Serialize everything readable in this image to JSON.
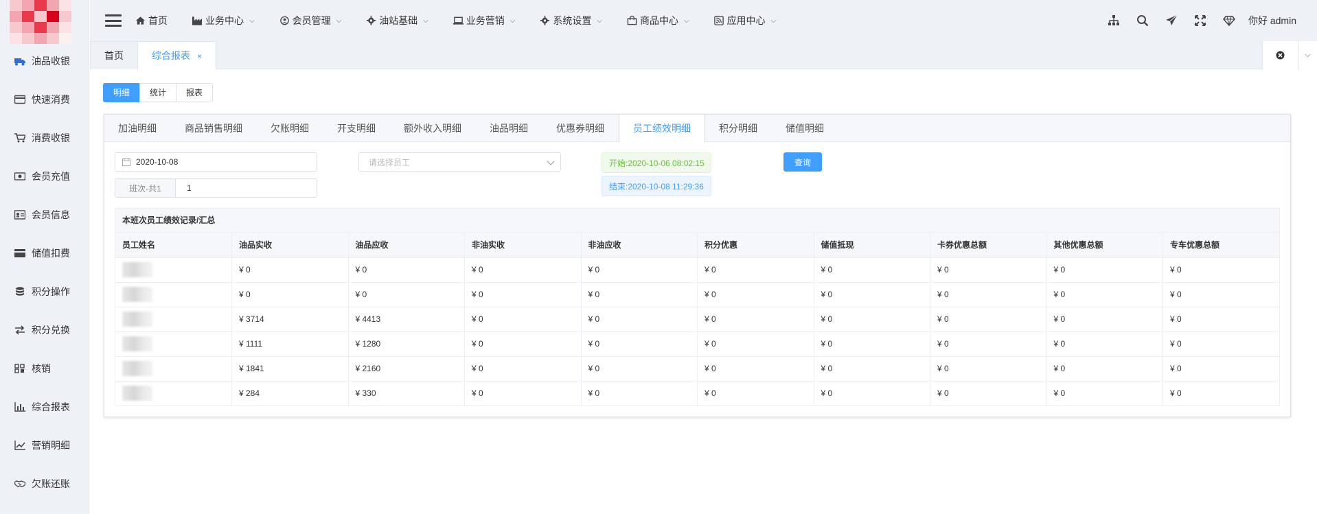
{
  "sidebar": {
    "items": [
      {
        "label": "油品收银",
        "icon": "truck-icon"
      },
      {
        "label": "快速消费",
        "icon": "credit-card-icon"
      },
      {
        "label": "消费收银",
        "icon": "cart-icon"
      },
      {
        "label": "会员充值",
        "icon": "money-icon"
      },
      {
        "label": "会员信息",
        "icon": "id-card-icon"
      },
      {
        "label": "储值扣费",
        "icon": "card-icon"
      },
      {
        "label": "积分操作",
        "icon": "database-icon"
      },
      {
        "label": "积分兑换",
        "icon": "exchange-icon"
      },
      {
        "label": "核销",
        "icon": "grid-icon"
      },
      {
        "label": "综合报表",
        "icon": "bar-chart-icon"
      },
      {
        "label": "营销明细",
        "icon": "line-chart-icon"
      },
      {
        "label": "欠账还账",
        "icon": "handshake-icon"
      }
    ]
  },
  "topnav": {
    "items": [
      {
        "label": "首页",
        "icon": "home-icon",
        "dropdown": false
      },
      {
        "label": "业务中心",
        "icon": "factory-icon",
        "dropdown": true
      },
      {
        "label": "会员管理",
        "icon": "user-circle-icon",
        "dropdown": true
      },
      {
        "label": "油站基础",
        "icon": "cog-icon",
        "dropdown": true
      },
      {
        "label": "业务营销",
        "icon": "laptop-icon",
        "dropdown": true
      },
      {
        "label": "系统设置",
        "icon": "cog-icon",
        "dropdown": true
      },
      {
        "label": "商品中心",
        "icon": "shopping-bag-icon",
        "dropdown": true
      },
      {
        "label": "应用中心",
        "icon": "rss-icon",
        "dropdown": true
      }
    ],
    "user_label": "你好 admin"
  },
  "page_tabs": [
    {
      "label": "首页",
      "active": false
    },
    {
      "label": "综合报表",
      "active": true,
      "close": "×"
    }
  ],
  "view_buttons": [
    "明细",
    "统计",
    "报表"
  ],
  "report_tabs": [
    "加油明细",
    "商品销售明细",
    "欠账明细",
    "开支明细",
    "额外收入明细",
    "油品明细",
    "优惠券明细",
    "员工绩效明细",
    "积分明细",
    "储值明细"
  ],
  "active_report_tab": "员工绩效明细",
  "filters": {
    "date": "2020-10-08",
    "shift_prefix": "班次-共1",
    "shift_value": "1",
    "employee_placeholder": "请选择员工",
    "start_time": "开始:2020-10-06 08:02:15",
    "end_time": "结束:2020-10-08 11:29:36",
    "query_label": "查询"
  },
  "table": {
    "title": "本班次员工绩效记录/汇总",
    "columns": [
      "员工姓名",
      "油品实收",
      "油品应收",
      "非油实收",
      "非油应收",
      "积分优惠",
      "储值抵现",
      "卡券优惠总额",
      "其他优惠总额",
      "专车优惠总额"
    ],
    "rows": [
      [
        "",
        "¥ 0",
        "¥ 0",
        "¥ 0",
        "¥ 0",
        "¥ 0",
        "¥ 0",
        "¥ 0",
        "¥ 0",
        "¥ 0"
      ],
      [
        "",
        "¥ 0",
        "¥ 0",
        "¥ 0",
        "¥ 0",
        "¥ 0",
        "¥ 0",
        "¥ 0",
        "¥ 0",
        "¥ 0"
      ],
      [
        "",
        "¥ 3714",
        "¥ 4413",
        "¥ 0",
        "¥ 0",
        "¥ 0",
        "¥ 0",
        "¥ 0",
        "¥ 0",
        "¥ 0"
      ],
      [
        "",
        "¥ 1111",
        "¥ 1280",
        "¥ 0",
        "¥ 0",
        "¥ 0",
        "¥ 0",
        "¥ 0",
        "¥ 0",
        "¥ 0"
      ],
      [
        "",
        "¥ 1841",
        "¥ 2160",
        "¥ 0",
        "¥ 0",
        "¥ 0",
        "¥ 0",
        "¥ 0",
        "¥ 0",
        "¥ 0"
      ],
      [
        "",
        "¥ 284",
        "¥ 330",
        "¥ 0",
        "¥ 0",
        "¥ 0",
        "¥ 0",
        "¥ 0",
        "¥ 0",
        "¥ 0"
      ]
    ]
  },
  "colors": {
    "accent": "#409eff",
    "success": "#67c23a",
    "sidebar_bg": "#eef1f6"
  }
}
